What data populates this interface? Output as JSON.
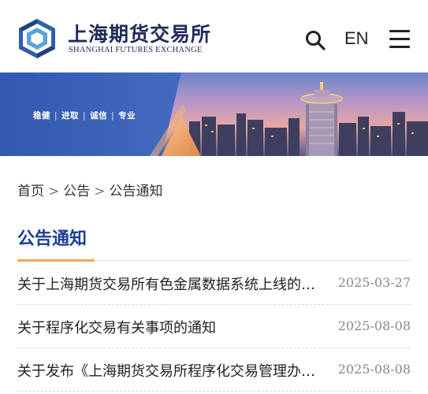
{
  "header": {
    "brand_cn": "上海期货交易所",
    "brand_en": "SHANGHAI FUTURES EXCHANGE",
    "logo_icon": "shfe-logo-icon",
    "search_icon": "search-icon",
    "language_label": "EN",
    "menu_icon": "hamburger-menu-icon"
  },
  "banner": {
    "slogan": [
      "稳健",
      "进取",
      "诚信",
      "专业"
    ],
    "separator": "|",
    "image": "city-skyline-banner"
  },
  "breadcrumb": {
    "items": [
      "首页",
      "公告",
      "公告通知"
    ],
    "separator": ">"
  },
  "section": {
    "title": "公告通知"
  },
  "news": [
    {
      "title": "关于上海期货交易所有色金属数据系统上线的通知",
      "date": "2025-03-27"
    },
    {
      "title": "关于程序化交易有关事项的通知",
      "date": "2025-08-08"
    },
    {
      "title": "关于发布《上海期货交易所程序化交易管理办法》的公告",
      "date": "2025-08-08"
    }
  ],
  "colors": {
    "brand_navy": "#1f2a5a",
    "title_blue": "#1b3f96",
    "accent_orange": "#f0a55a",
    "banner_blue": "#3e63b8"
  }
}
